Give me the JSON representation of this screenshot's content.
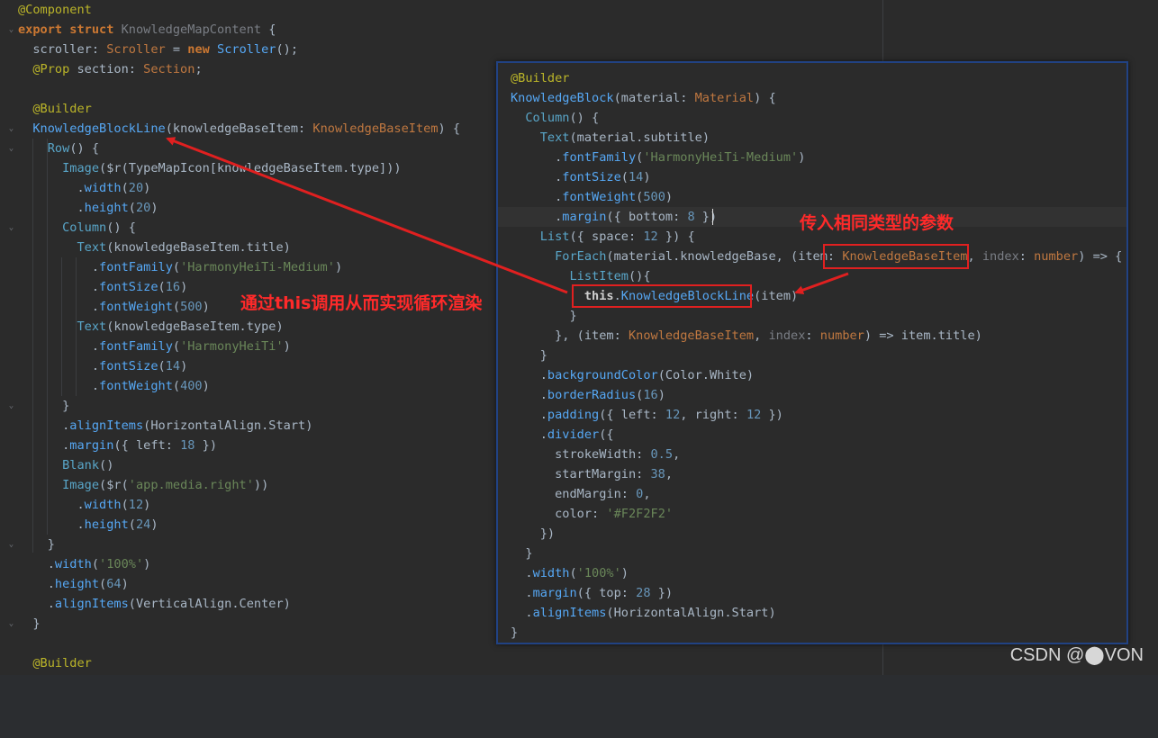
{
  "editor": {
    "left_lines": [
      [
        [
          "an",
          "@Component"
        ]
      ],
      [
        [
          "kw",
          "export struct "
        ],
        [
          "gr",
          "KnowledgeMapContent"
        ],
        [
          "pl",
          " {"
        ]
      ],
      [
        [
          "pl",
          "  scroller: "
        ],
        [
          "ty",
          "Scroller"
        ],
        [
          "pl",
          " = "
        ],
        [
          "kw",
          "new "
        ],
        [
          "fn",
          "Scroller"
        ],
        [
          "pl",
          "();"
        ]
      ],
      [
        [
          "pl",
          "  "
        ],
        [
          "an",
          "@Prop"
        ],
        [
          "pl",
          " section: "
        ],
        [
          "ty",
          "Section"
        ],
        [
          "pl",
          ";"
        ]
      ],
      [
        [
          "pl",
          ""
        ]
      ],
      [
        [
          "pl",
          "  "
        ],
        [
          "an",
          "@Builder"
        ]
      ],
      [
        [
          "pl",
          "  "
        ],
        [
          "fn",
          "KnowledgeBlockLine"
        ],
        [
          "pl",
          "(knowledgeBaseItem: "
        ],
        [
          "ty",
          "KnowledgeBaseItem"
        ],
        [
          "pl",
          ") {"
        ]
      ],
      [
        [
          "pl",
          "    "
        ],
        [
          "cy",
          "Row"
        ],
        [
          "pl",
          "() {"
        ]
      ],
      [
        [
          "pl",
          "      "
        ],
        [
          "cy",
          "Image"
        ],
        [
          "pl",
          "($r(TypeMapIcon[knowledgeBaseItem.type]))"
        ]
      ],
      [
        [
          "pl",
          "        ."
        ],
        [
          "fn",
          "width"
        ],
        [
          "pl",
          "("
        ],
        [
          "num",
          "20"
        ],
        [
          "pl",
          ")"
        ]
      ],
      [
        [
          "pl",
          "        ."
        ],
        [
          "fn",
          "height"
        ],
        [
          "pl",
          "("
        ],
        [
          "num",
          "20"
        ],
        [
          "pl",
          ")"
        ]
      ],
      [
        [
          "pl",
          "      "
        ],
        [
          "cy",
          "Column"
        ],
        [
          "pl",
          "() {"
        ]
      ],
      [
        [
          "pl",
          "        "
        ],
        [
          "cy",
          "Text"
        ],
        [
          "pl",
          "(knowledgeBaseItem.title)"
        ]
      ],
      [
        [
          "pl",
          "          ."
        ],
        [
          "fn",
          "fontFamily"
        ],
        [
          "pl",
          "("
        ],
        [
          "st",
          "'HarmonyHeiTi-Medium'"
        ],
        [
          "pl",
          ")"
        ]
      ],
      [
        [
          "pl",
          "          ."
        ],
        [
          "fn",
          "fontSize"
        ],
        [
          "pl",
          "("
        ],
        [
          "num",
          "16"
        ],
        [
          "pl",
          ")"
        ]
      ],
      [
        [
          "pl",
          "          ."
        ],
        [
          "fn",
          "fontWeight"
        ],
        [
          "pl",
          "("
        ],
        [
          "num",
          "500"
        ],
        [
          "pl",
          ")"
        ]
      ],
      [
        [
          "pl",
          "        "
        ],
        [
          "cy",
          "Text"
        ],
        [
          "pl",
          "(knowledgeBaseItem.type)"
        ]
      ],
      [
        [
          "pl",
          "          ."
        ],
        [
          "fn",
          "fontFamily"
        ],
        [
          "pl",
          "("
        ],
        [
          "st",
          "'HarmonyHeiTi'"
        ],
        [
          "pl",
          ")"
        ]
      ],
      [
        [
          "pl",
          "          ."
        ],
        [
          "fn",
          "fontSize"
        ],
        [
          "pl",
          "("
        ],
        [
          "num",
          "14"
        ],
        [
          "pl",
          ")"
        ]
      ],
      [
        [
          "pl",
          "          ."
        ],
        [
          "fn",
          "fontWeight"
        ],
        [
          "pl",
          "("
        ],
        [
          "num",
          "400"
        ],
        [
          "pl",
          ")"
        ]
      ],
      [
        [
          "pl",
          "      }"
        ]
      ],
      [
        [
          "pl",
          "      ."
        ],
        [
          "fn",
          "alignItems"
        ],
        [
          "pl",
          "(HorizontalAlign.Start)"
        ]
      ],
      [
        [
          "pl",
          "      ."
        ],
        [
          "fn",
          "margin"
        ],
        [
          "pl",
          "({ left: "
        ],
        [
          "num",
          "18"
        ],
        [
          "pl",
          " })"
        ]
      ],
      [
        [
          "pl",
          "      "
        ],
        [
          "cy",
          "Blank"
        ],
        [
          "pl",
          "()"
        ]
      ],
      [
        [
          "pl",
          "      "
        ],
        [
          "cy",
          "Image"
        ],
        [
          "pl",
          "($r("
        ],
        [
          "st",
          "'app.media.right'"
        ],
        [
          "pl",
          "))"
        ]
      ],
      [
        [
          "pl",
          "        ."
        ],
        [
          "fn",
          "width"
        ],
        [
          "pl",
          "("
        ],
        [
          "num",
          "12"
        ],
        [
          "pl",
          ")"
        ]
      ],
      [
        [
          "pl",
          "        ."
        ],
        [
          "fn",
          "height"
        ],
        [
          "pl",
          "("
        ],
        [
          "num",
          "24"
        ],
        [
          "pl",
          ")"
        ]
      ],
      [
        [
          "pl",
          "    }"
        ]
      ],
      [
        [
          "pl",
          "    ."
        ],
        [
          "fn",
          "width"
        ],
        [
          "pl",
          "("
        ],
        [
          "st",
          "'100%'"
        ],
        [
          "pl",
          ")"
        ]
      ],
      [
        [
          "pl",
          "    ."
        ],
        [
          "fn",
          "height"
        ],
        [
          "pl",
          "("
        ],
        [
          "num",
          "64"
        ],
        [
          "pl",
          ")"
        ]
      ],
      [
        [
          "pl",
          "    ."
        ],
        [
          "fn",
          "alignItems"
        ],
        [
          "pl",
          "(VerticalAlign.Center)"
        ]
      ],
      [
        [
          "pl",
          "  }"
        ]
      ],
      [
        [
          "pl",
          ""
        ]
      ],
      [
        [
          "pl",
          "  "
        ],
        [
          "an",
          "@Builder"
        ]
      ]
    ],
    "popup_lines": [
      [
        [
          "an",
          "@Builder"
        ]
      ],
      [
        [
          "fn",
          "KnowledgeBlock"
        ],
        [
          "pl",
          "(material: "
        ],
        [
          "ty",
          "Material"
        ],
        [
          "pl",
          ") {"
        ]
      ],
      [
        [
          "pl",
          "  "
        ],
        [
          "cy",
          "Column"
        ],
        [
          "pl",
          "() {"
        ]
      ],
      [
        [
          "pl",
          "    "
        ],
        [
          "cy",
          "Text"
        ],
        [
          "pl",
          "(material.subtitle)"
        ]
      ],
      [
        [
          "pl",
          "      ."
        ],
        [
          "fn",
          "fontFamily"
        ],
        [
          "pl",
          "("
        ],
        [
          "st",
          "'HarmonyHeiTi-Medium'"
        ],
        [
          "pl",
          ")"
        ]
      ],
      [
        [
          "pl",
          "      ."
        ],
        [
          "fn",
          "fontSize"
        ],
        [
          "pl",
          "("
        ],
        [
          "num",
          "14"
        ],
        [
          "pl",
          ")"
        ]
      ],
      [
        [
          "pl",
          "      ."
        ],
        [
          "fn",
          "fontWeight"
        ],
        [
          "pl",
          "("
        ],
        [
          "num",
          "500"
        ],
        [
          "pl",
          ")"
        ]
      ],
      [
        [
          "pl",
          "      ."
        ],
        [
          "fn",
          "margin"
        ],
        [
          "pl",
          "({ bottom: "
        ],
        [
          "num",
          "8"
        ],
        [
          "pl",
          " })"
        ]
      ],
      [
        [
          "pl",
          "    "
        ],
        [
          "cy",
          "List"
        ],
        [
          "pl",
          "({ space: "
        ],
        [
          "num",
          "12"
        ],
        [
          "pl",
          " }) {"
        ]
      ],
      [
        [
          "pl",
          "      "
        ],
        [
          "cy",
          "ForEach"
        ],
        [
          "pl",
          "(material.knowledgeBase, (item: "
        ],
        [
          "ty",
          "KnowledgeBaseItem"
        ],
        [
          "pl",
          ", "
        ],
        [
          "gr",
          "index"
        ],
        [
          "pl",
          ": "
        ],
        [
          "ty",
          "number"
        ],
        [
          "pl",
          ") => {"
        ]
      ],
      [
        [
          "pl",
          "        "
        ],
        [
          "cy",
          "ListItem"
        ],
        [
          "pl",
          "(){"
        ]
      ],
      [
        [
          "pl",
          "          "
        ],
        [
          "wh",
          "this"
        ],
        [
          "pl",
          "."
        ],
        [
          "fn",
          "KnowledgeBlockLine"
        ],
        [
          "pl",
          "(item)"
        ]
      ],
      [
        [
          "pl",
          "        }"
        ]
      ],
      [
        [
          "pl",
          "      }, (item: "
        ],
        [
          "ty",
          "KnowledgeBaseItem"
        ],
        [
          "pl",
          ", "
        ],
        [
          "gr",
          "index"
        ],
        [
          "pl",
          ": "
        ],
        [
          "ty",
          "number"
        ],
        [
          "pl",
          ") => item.title)"
        ]
      ],
      [
        [
          "pl",
          "    }"
        ]
      ],
      [
        [
          "pl",
          "    ."
        ],
        [
          "fn",
          "backgroundColor"
        ],
        [
          "pl",
          "(Color.White)"
        ]
      ],
      [
        [
          "pl",
          "    ."
        ],
        [
          "fn",
          "borderRadius"
        ],
        [
          "pl",
          "("
        ],
        [
          "num",
          "16"
        ],
        [
          "pl",
          ")"
        ]
      ],
      [
        [
          "pl",
          "    ."
        ],
        [
          "fn",
          "padding"
        ],
        [
          "pl",
          "({ left: "
        ],
        [
          "num",
          "12"
        ],
        [
          "pl",
          ", right: "
        ],
        [
          "num",
          "12"
        ],
        [
          "pl",
          " })"
        ]
      ],
      [
        [
          "pl",
          "    ."
        ],
        [
          "fn",
          "divider"
        ],
        [
          "pl",
          "({"
        ]
      ],
      [
        [
          "pl",
          "      strokeWidth: "
        ],
        [
          "num",
          "0.5"
        ],
        [
          "pl",
          ","
        ]
      ],
      [
        [
          "pl",
          "      startMargin: "
        ],
        [
          "num",
          "38"
        ],
        [
          "pl",
          ","
        ]
      ],
      [
        [
          "pl",
          "      endMargin: "
        ],
        [
          "num",
          "0"
        ],
        [
          "pl",
          ","
        ]
      ],
      [
        [
          "pl",
          "      color: "
        ],
        [
          "st",
          "'#F2F2F2'"
        ]
      ],
      [
        [
          "pl",
          "    })"
        ]
      ],
      [
        [
          "pl",
          "  }"
        ]
      ],
      [
        [
          "pl",
          "  ."
        ],
        [
          "fn",
          "width"
        ],
        [
          "pl",
          "("
        ],
        [
          "st",
          "'100%'"
        ],
        [
          "pl",
          ")"
        ]
      ],
      [
        [
          "pl",
          "  ."
        ],
        [
          "fn",
          "margin"
        ],
        [
          "pl",
          "({ top: "
        ],
        [
          "num",
          "28"
        ],
        [
          "pl",
          " })"
        ]
      ],
      [
        [
          "pl",
          "  ."
        ],
        [
          "fn",
          "alignItems"
        ],
        [
          "pl",
          "(HorizontalAlign.Start)"
        ]
      ],
      [
        [
          "pl",
          "}"
        ]
      ]
    ]
  },
  "annotations": {
    "loop_render": "通过this调用从而实现循环渲染",
    "same_type_param": "传入相同类型的参数"
  },
  "watermark": "CSDN @⬤VON",
  "colors": {
    "background": "#2b2b2b",
    "annotation_red": "#e02020",
    "popup_border": "#214283"
  }
}
